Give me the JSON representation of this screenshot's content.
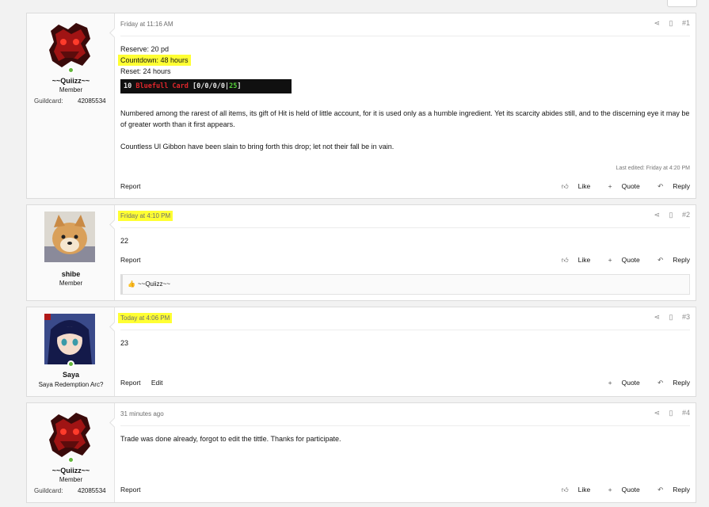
{
  "posts": [
    {
      "username": "~~Quiizz~~",
      "user_title": "Member",
      "guildcard_label": "Guildcard:",
      "guildcard_value": "42085534",
      "date": "Friday at 11:16 AM",
      "post_number": "#1",
      "lines": [
        "Reserve: 20 pd",
        "Countdown: 48 hours",
        "Reset: 24 hours"
      ],
      "item_card": {
        "prefix": "10",
        "name": "Bluefull Card",
        "stats": "[0/0/0/0|",
        "hit": "25",
        "close": "]"
      },
      "paragraph_1": "Numbered among the rarest of all items, its gift of Hit is held of little account, for it is used only as a humble ingredient. Yet its scarcity abides still, and to the discerning eye it may be of greater worth than it first appears.",
      "paragraph_2": "Countless Ul Gibbon have been slain to bring forth this drop; let not their fall be in vain.",
      "last_edited": "Last edited: Friday at 4:20 PM",
      "actions_left": [
        "Report"
      ],
      "actions_right": [
        "Like",
        "Quote",
        "Reply"
      ]
    },
    {
      "username": "shibe",
      "user_title": "Member",
      "date": "Friday at 4:10 PM",
      "post_number": "#2",
      "content": "22",
      "actions_left": [
        "Report"
      ],
      "actions_right": [
        "Like",
        "Quote",
        "Reply"
      ],
      "reaction_user": "~~Quiizz~~"
    },
    {
      "username": "Saya",
      "user_title": "Saya Redemption Arc?",
      "date": "Today at 4:06 PM",
      "post_number": "#3",
      "content": "23",
      "actions_left": [
        "Report",
        "Edit"
      ],
      "actions_right": [
        "Quote",
        "Reply"
      ]
    },
    {
      "username": "~~Quiizz~~",
      "user_title": "Member",
      "guildcard_label": "Guildcard:",
      "guildcard_value": "42085534",
      "date": "31 minutes ago",
      "post_number": "#4",
      "content": "Trade was done already, forgot to edit the tittle. Thanks for participate.",
      "actions_left": [
        "Report"
      ],
      "actions_right": [
        "Like",
        "Quote",
        "Reply"
      ]
    }
  ],
  "icons": {
    "share": "share-icon",
    "bookmark": "bookmark-icon",
    "like": "thumbs-up-icon",
    "quote": "plus-icon",
    "reply": "reply-icon",
    "online": "online-indicator-icon"
  },
  "colors": {
    "highlight": "#ffff33",
    "online": "#63b63a",
    "card_red": "#e0262b",
    "card_green": "#55d23a"
  }
}
